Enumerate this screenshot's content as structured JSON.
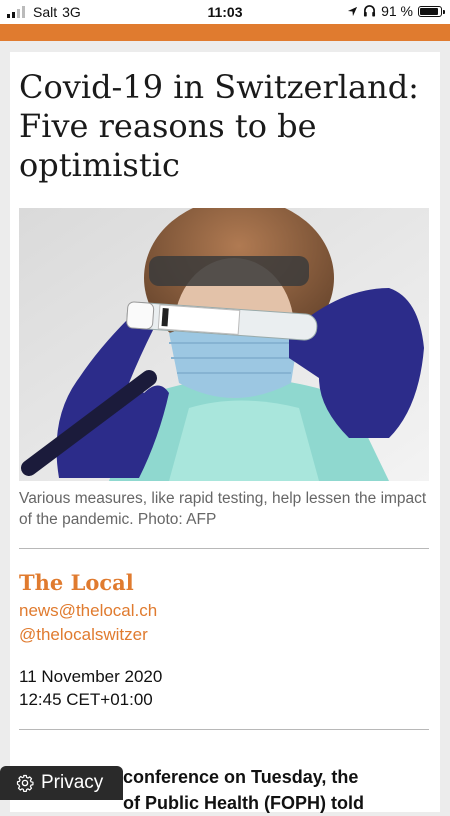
{
  "status_bar": {
    "carrier": "Salt",
    "network": "3G",
    "time": "11:03",
    "battery": "91 %"
  },
  "colors": {
    "accent": "#e07b2f",
    "privacy_bg": "#2a2a2a"
  },
  "article": {
    "headline": "Covid-19 in Switzerland: Five reasons to be optimistic",
    "photo_icon": "covid-test-photo",
    "caption": "Various measures, like rapid testing, help lessen the impact of the pandemic. Photo: AFP",
    "source": "The Local",
    "email": "news@thelocal.ch",
    "twitter": "@thelocalswitzer",
    "date": "11 November 2020",
    "time": "12:45 CET+01:00",
    "body_line1": "conference on Tuesday, the",
    "body_line2": "of Public Health (FOPH) told"
  },
  "privacy_button": {
    "label": "Privacy",
    "icon": "gear-icon"
  }
}
